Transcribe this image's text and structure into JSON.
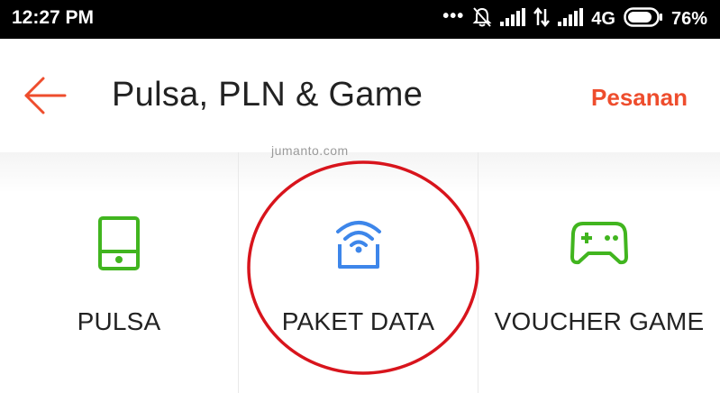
{
  "status_bar": {
    "time": "12:27 PM",
    "dots": "•••",
    "network": "4G",
    "battery": "76%"
  },
  "header": {
    "title": "Pulsa, PLN & Game",
    "orders_label": "Pesanan"
  },
  "watermark": "jumanto.com",
  "categories": [
    {
      "label": "PULSA",
      "icon": "phone-icon",
      "color": "#41b51f"
    },
    {
      "label": "PAKET DATA",
      "icon": "wifi-router-icon",
      "color": "#3d86ea"
    },
    {
      "label": "VOUCHER GAME",
      "icon": "gamepad-icon",
      "color": "#41b51f"
    }
  ],
  "colors": {
    "accent": "#ee4d2d",
    "annotation": "#d8141c"
  }
}
